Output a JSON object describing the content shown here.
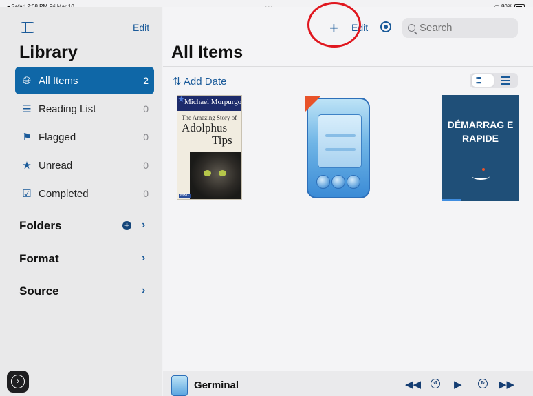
{
  "status_bar": {
    "left": "◂ Safari  2:08 PM  Fri Mar 10",
    "dots": "•••",
    "battery": "80%"
  },
  "sidebar": {
    "edit_label": "Edit",
    "title": "Library",
    "items": [
      {
        "label": "All Items",
        "count": "2",
        "icon": "globe-icon"
      },
      {
        "label": "Reading List",
        "count": "0",
        "icon": "list-icon"
      },
      {
        "label": "Flagged",
        "count": "0",
        "icon": "flag-icon"
      },
      {
        "label": "Unread",
        "count": "0",
        "icon": "star-icon"
      },
      {
        "label": "Completed",
        "count": "0",
        "icon": "checkbox-icon"
      }
    ],
    "sections": [
      {
        "label": "Folders"
      },
      {
        "label": "Format"
      },
      {
        "label": "Source"
      }
    ]
  },
  "toolbar": {
    "add_label": "+",
    "edit_label": "Edit",
    "search_placeholder": "Search"
  },
  "main": {
    "title": "All Items",
    "sort_label": "⇅ Add Date"
  },
  "books": [
    {
      "series": "Michael Morpurgo",
      "subtitle": "The Amazing Story of",
      "title": "Adolphus",
      "title2": "Tips"
    },
    {
      "type": "placeholder-ebook"
    },
    {
      "title": "DÉMARRAG E RAPIDE"
    }
  ],
  "player": {
    "title": "Germinal"
  },
  "colors": {
    "accent": "#0f67a7",
    "annotation": "#e0171f",
    "book3_bg": "#1f4f78"
  }
}
